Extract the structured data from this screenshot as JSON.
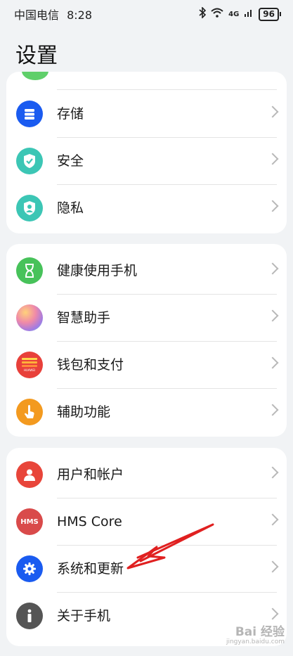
{
  "status_bar": {
    "carrier": "中国电信",
    "time": "8:28",
    "network": "4G",
    "battery": "96"
  },
  "page_title": "设置",
  "groups": [
    {
      "items": [
        {
          "label": "存储",
          "icon": "storage-icon",
          "color": "#1a5bf0"
        },
        {
          "label": "安全",
          "icon": "shield-check-icon",
          "color": "#3cc6b5"
        },
        {
          "label": "隐私",
          "icon": "privacy-shield-icon",
          "color": "#3cc6b5"
        }
      ]
    },
    {
      "items": [
        {
          "label": "健康使用手机",
          "icon": "hourglass-icon",
          "color": "#47c25a"
        },
        {
          "label": "智慧助手",
          "icon": "assistant-orb-icon",
          "color": "#c879d6"
        },
        {
          "label": "钱包和支付",
          "icon": "wallet-icon",
          "color": "#e8403a"
        },
        {
          "label": "辅助功能",
          "icon": "accessibility-hand-icon",
          "color": "#f39a1f"
        }
      ]
    },
    {
      "items": [
        {
          "label": "用户和帐户",
          "icon": "user-icon",
          "color": "#e8453a"
        },
        {
          "label": "HMS Core",
          "icon": "hms-icon",
          "color": "#d94a4a",
          "icon_text": "HMS"
        },
        {
          "label": "系统和更新",
          "icon": "gear-icon",
          "color": "#1a5bf0"
        },
        {
          "label": "关于手机",
          "icon": "info-icon",
          "color": "#555555"
        }
      ]
    }
  ],
  "wallet_icon_text": "HUAWEI",
  "watermark": {
    "brand": "Bai 经验",
    "url": "jingyan.baidu.com"
  },
  "annotation_arrow_color": "#e02020"
}
